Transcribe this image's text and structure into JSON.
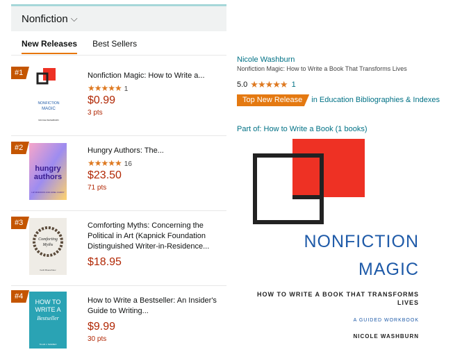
{
  "category": {
    "label": "Nonfiction",
    "chevron": "chevron-down-icon"
  },
  "tabs": [
    {
      "label": "New Releases",
      "active": true
    },
    {
      "label": "Best Sellers",
      "active": false
    }
  ],
  "items": [
    {
      "rank": "#1",
      "title": "Nonfiction Magic: How to Write a...",
      "stars": "★★★★★",
      "rating_count": "1",
      "price": "$0.99",
      "points": "3 pts",
      "cover": {
        "line1": "NONFICTION",
        "line2": "MAGIC",
        "author": "NICOLE WASHBURN"
      }
    },
    {
      "rank": "#2",
      "title": "Hungry Authors: The...",
      "stars": "★★★★★",
      "rating_count": "16",
      "price": "$23.50",
      "points": "71 pts",
      "cover": {
        "line1": "hungry",
        "line2": "authors",
        "author": "LIZ MORROW AND ARIEL CURRY"
      }
    },
    {
      "rank": "#3",
      "title": "Comforting Myths: Concerning the Political in Art (Kapnick Foundation Distinguished Writer-in-Residence...",
      "price": "$18.95",
      "cover": {
        "line1": "Comforting",
        "line2": "Myths",
        "author": "Keith Blueschkov"
      }
    },
    {
      "rank": "#4",
      "title": "How to Write a Bestseller: An Insider's Guide to Writing...",
      "price": "$9.99",
      "points": "30 pts",
      "cover": {
        "line1": "HOW TO",
        "line2": "WRITE A",
        "line3": "Bestseller",
        "author": "TILAR J. MAZZEO"
      }
    }
  ],
  "detail": {
    "author": "Nicole Washburn",
    "subtitle": "Nonfiction Magic: How to Write a Book That Transforms Lives",
    "rating": "5.0",
    "stars": "★★★★★",
    "rating_count": "1",
    "badge": "Top New Release",
    "badge_category": "in Education Bibliographies & Indexes",
    "part_of": "Part of: How to Write a Book (1 books)",
    "cover": {
      "line1": "NONFICTION",
      "line2": "MAGIC",
      "subtitle": "HOW TO WRITE A BOOK THAT TRANSFORMS LIVES",
      "workbook": "A GUIDED WORKBOOK",
      "author": "NICOLE WASHBURN"
    }
  },
  "colors": {
    "accent": "#e77600",
    "price": "#b12704",
    "link": "#007185",
    "star": "#de7921",
    "rank": "#c45500",
    "cover_red": "#ee3124",
    "cover_blue": "#1e5aa8"
  }
}
